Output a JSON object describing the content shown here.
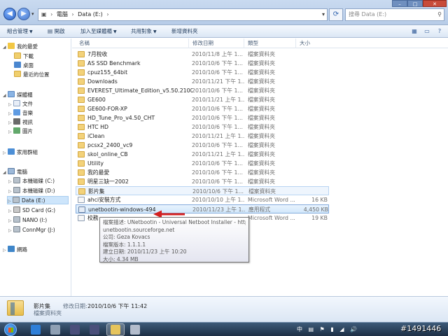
{
  "address": {
    "crumbs": [
      "電腦",
      "Data (E:)"
    ]
  },
  "search": {
    "placeholder": "搜尋 Data (E:)"
  },
  "commands": [
    "組合管理",
    "開啟",
    "加入至媒體櫃",
    "共用對象",
    "新增資料夾"
  ],
  "nav": [
    {
      "label": "我的最愛",
      "icon": "star-icon",
      "tri": "◢"
    },
    {
      "label": "下載",
      "icon": "folder-icon",
      "tri": ""
    },
    {
      "label": "桌面",
      "icon": "desktop-icon",
      "tri": ""
    },
    {
      "label": "最近的位置",
      "icon": "folder-icon",
      "tri": ""
    },
    {
      "label": "媒體櫃",
      "icon": "library-icon",
      "tri": "◢"
    },
    {
      "label": "文件",
      "icon": "documents-icon",
      "tri": "▷"
    },
    {
      "label": "音樂",
      "icon": "music-icon",
      "tri": "▷"
    },
    {
      "label": "視訊",
      "icon": "video-icon",
      "tri": "▷"
    },
    {
      "label": "圖片",
      "icon": "pictures-icon",
      "tri": "▷"
    },
    {
      "label": "家用群組",
      "icon": "homegroup-icon",
      "tri": "▷"
    },
    {
      "label": "電腦",
      "icon": "computer-icon",
      "tri": "◢"
    },
    {
      "label": "本機磁碟 (C:)",
      "icon": "drive-icon",
      "tri": "▷"
    },
    {
      "label": "本機磁碟 (D:)",
      "icon": "drive-icon",
      "tri": "▷"
    },
    {
      "label": "Data (E:)",
      "icon": "drive-icon",
      "tri": "▷"
    },
    {
      "label": "SD Card (G:)",
      "icon": "sd-card-icon",
      "tri": "▷"
    },
    {
      "label": "NANO (I:)",
      "icon": "drive-icon",
      "tri": "▷"
    },
    {
      "label": "ConnMgr (J:)",
      "icon": "drive-icon",
      "tri": "▷"
    },
    {
      "label": "網路",
      "icon": "network-icon",
      "tri": "▷"
    }
  ],
  "columns": {
    "name": "名稱",
    "date": "修改日期",
    "type": "類型",
    "size": "大小"
  },
  "files": [
    {
      "name": "7月稅收",
      "date": "2010/11/8 上午 1...",
      "type": "檔案資料夾",
      "size": "",
      "kind": "folder"
    },
    {
      "name": "AS SSD Benchmark",
      "date": "2010/10/6 下午 1...",
      "type": "檔案資料夾",
      "size": "",
      "kind": "folder"
    },
    {
      "name": "cpuz155_64bit",
      "date": "2010/10/6 下午 1...",
      "type": "檔案資料夾",
      "size": "",
      "kind": "folder"
    },
    {
      "name": "Downloads",
      "date": "2010/11/21 下午 1...",
      "type": "檔案資料夾",
      "size": "",
      "kind": "folder"
    },
    {
      "name": "EVEREST_Ultimate_Edition_v5.50.2100...",
      "date": "2010/10/6 下午 1...",
      "type": "檔案資料夾",
      "size": "",
      "kind": "folder"
    },
    {
      "name": "GE600",
      "date": "2010/11/21 上午 1...",
      "type": "檔案資料夾",
      "size": "",
      "kind": "folder"
    },
    {
      "name": "GE600-FOR-XP",
      "date": "2010/10/6 下午 1...",
      "type": "檔案資料夾",
      "size": "",
      "kind": "folder"
    },
    {
      "name": "HD_Tune_Pro_v4.50_CHT",
      "date": "2010/10/6 下午 1...",
      "type": "檔案資料夾",
      "size": "",
      "kind": "folder"
    },
    {
      "name": "HTC HD",
      "date": "2010/10/6 下午 1...",
      "type": "檔案資料夾",
      "size": "",
      "kind": "folder"
    },
    {
      "name": "iClean",
      "date": "2010/11/21 上午 1...",
      "type": "檔案資料夾",
      "size": "",
      "kind": "folder"
    },
    {
      "name": "pcsx2_2400_vc9",
      "date": "2010/10/6 下午 1...",
      "type": "檔案資料夾",
      "size": "",
      "kind": "folder"
    },
    {
      "name": "skol_online_CB",
      "date": "2010/11/21 上午 1...",
      "type": "檔案資料夾",
      "size": "",
      "kind": "folder"
    },
    {
      "name": "Utility",
      "date": "2010/10/6 下午 1...",
      "type": "檔案資料夾",
      "size": "",
      "kind": "folder"
    },
    {
      "name": "我的最愛",
      "date": "2010/10/6 下午 1...",
      "type": "檔案資料夾",
      "size": "",
      "kind": "folder"
    },
    {
      "name": "明星三缺一2002",
      "date": "2010/10/6 下午 1...",
      "type": "檔案資料夾",
      "size": "",
      "kind": "folder"
    },
    {
      "name": "影片集",
      "date": "2010/10/6 下午 1...",
      "type": "檔案資料夾",
      "size": "",
      "kind": "folder"
    },
    {
      "name": "ahci安裝方式",
      "date": "2010/10/10 上午 1...",
      "type": "Microsoft Word ...",
      "size": "16 KB",
      "kind": "file"
    },
    {
      "name": "unetbootin-windows-494",
      "date": "2010/11/23 上午 1...",
      "type": "應用程式",
      "size": "4,450 KB",
      "kind": "exe"
    },
    {
      "name": "校務",
      "date": "",
      "type": "Microsoft Word ...",
      "size": "19 KB",
      "kind": "file"
    }
  ],
  "tooltip": {
    "lines": [
      "檔案描述: UNetbootin - Universal Netboot Installer - http://",
      "unetbootin.sourceforge.net",
      "公司: Geza Kovacs",
      "檔案版本: 1.1.1.1",
      "建立日期: 2010/11/23 上午 10:20",
      "大小: 4.34 MB"
    ]
  },
  "details": {
    "name": "影片集",
    "modified_label": "修改日期:",
    "modified": "2010/10/6 下午 11:42",
    "type": "檔案資料夾"
  },
  "taskbar": {
    "tray": [
      "中",
      "▤",
      "⚑",
      "▮",
      "◢",
      "🔊"
    ],
    "watermark": "#1491446"
  },
  "colors": {
    "accent": "#84acdd",
    "arrow": "#d42020"
  }
}
